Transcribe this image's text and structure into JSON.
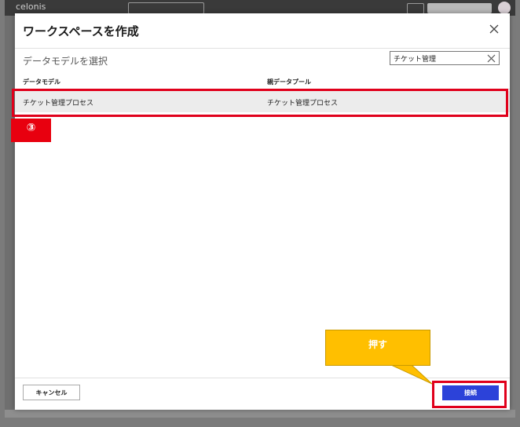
{
  "backdrop": {
    "logo_text": "celonis"
  },
  "modal": {
    "title": "ワークスペースを作成",
    "section_label": "データモデルを選択",
    "search": {
      "value": "チケット管理",
      "placeholder": ""
    },
    "table": {
      "headers": [
        "データモデル",
        "親データプール"
      ],
      "rows": [
        [
          "チケット管理プロセス",
          "チケット管理プロセス"
        ]
      ]
    },
    "cancel_label": "キャンセル",
    "connect_label": "接続"
  },
  "annotations": {
    "step_number": "③",
    "callout_text": "押す"
  },
  "colors": {
    "accent": "#2c42d9",
    "annotation_red": "#e0001b",
    "callout_yellow": "#ffbf00",
    "selected_row": "#ececec"
  }
}
